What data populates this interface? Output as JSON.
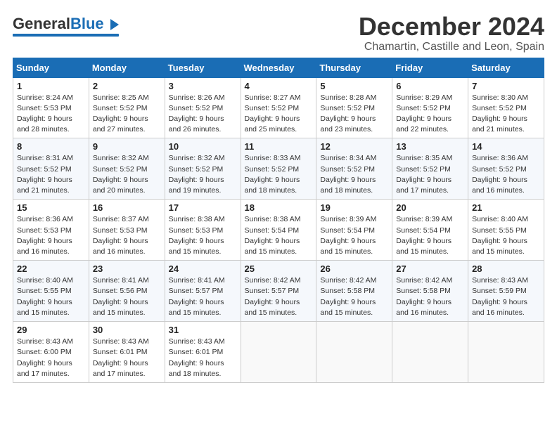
{
  "header": {
    "logo_general": "General",
    "logo_blue": "Blue",
    "main_title": "December 2024",
    "subtitle": "Chamartin, Castille and Leon, Spain"
  },
  "days_of_week": [
    "Sunday",
    "Monday",
    "Tuesday",
    "Wednesday",
    "Thursday",
    "Friday",
    "Saturday"
  ],
  "weeks": [
    [
      {
        "day": 1,
        "sunrise": "8:24 AM",
        "sunset": "5:53 PM",
        "daylight_hours": 9,
        "daylight_minutes": 28
      },
      {
        "day": 2,
        "sunrise": "8:25 AM",
        "sunset": "5:52 PM",
        "daylight_hours": 9,
        "daylight_minutes": 27
      },
      {
        "day": 3,
        "sunrise": "8:26 AM",
        "sunset": "5:52 PM",
        "daylight_hours": 9,
        "daylight_minutes": 26
      },
      {
        "day": 4,
        "sunrise": "8:27 AM",
        "sunset": "5:52 PM",
        "daylight_hours": 9,
        "daylight_minutes": 25
      },
      {
        "day": 5,
        "sunrise": "8:28 AM",
        "sunset": "5:52 PM",
        "daylight_hours": 9,
        "daylight_minutes": 23
      },
      {
        "day": 6,
        "sunrise": "8:29 AM",
        "sunset": "5:52 PM",
        "daylight_hours": 9,
        "daylight_minutes": 22
      },
      {
        "day": 7,
        "sunrise": "8:30 AM",
        "sunset": "5:52 PM",
        "daylight_hours": 9,
        "daylight_minutes": 21
      }
    ],
    [
      {
        "day": 8,
        "sunrise": "8:31 AM",
        "sunset": "5:52 PM",
        "daylight_hours": 9,
        "daylight_minutes": 21
      },
      {
        "day": 9,
        "sunrise": "8:32 AM",
        "sunset": "5:52 PM",
        "daylight_hours": 9,
        "daylight_minutes": 20
      },
      {
        "day": 10,
        "sunrise": "8:32 AM",
        "sunset": "5:52 PM",
        "daylight_hours": 9,
        "daylight_minutes": 19
      },
      {
        "day": 11,
        "sunrise": "8:33 AM",
        "sunset": "5:52 PM",
        "daylight_hours": 9,
        "daylight_minutes": 18
      },
      {
        "day": 12,
        "sunrise": "8:34 AM",
        "sunset": "5:52 PM",
        "daylight_hours": 9,
        "daylight_minutes": 18
      },
      {
        "day": 13,
        "sunrise": "8:35 AM",
        "sunset": "5:52 PM",
        "daylight_hours": 9,
        "daylight_minutes": 17
      },
      {
        "day": 14,
        "sunrise": "8:36 AM",
        "sunset": "5:52 PM",
        "daylight_hours": 9,
        "daylight_minutes": 16
      }
    ],
    [
      {
        "day": 15,
        "sunrise": "8:36 AM",
        "sunset": "5:53 PM",
        "daylight_hours": 9,
        "daylight_minutes": 16
      },
      {
        "day": 16,
        "sunrise": "8:37 AM",
        "sunset": "5:53 PM",
        "daylight_hours": 9,
        "daylight_minutes": 16
      },
      {
        "day": 17,
        "sunrise": "8:38 AM",
        "sunset": "5:53 PM",
        "daylight_hours": 9,
        "daylight_minutes": 15
      },
      {
        "day": 18,
        "sunrise": "8:38 AM",
        "sunset": "5:54 PM",
        "daylight_hours": 9,
        "daylight_minutes": 15
      },
      {
        "day": 19,
        "sunrise": "8:39 AM",
        "sunset": "5:54 PM",
        "daylight_hours": 9,
        "daylight_minutes": 15
      },
      {
        "day": 20,
        "sunrise": "8:39 AM",
        "sunset": "5:54 PM",
        "daylight_hours": 9,
        "daylight_minutes": 15
      },
      {
        "day": 21,
        "sunrise": "8:40 AM",
        "sunset": "5:55 PM",
        "daylight_hours": 9,
        "daylight_minutes": 15
      }
    ],
    [
      {
        "day": 22,
        "sunrise": "8:40 AM",
        "sunset": "5:55 PM",
        "daylight_hours": 9,
        "daylight_minutes": 15
      },
      {
        "day": 23,
        "sunrise": "8:41 AM",
        "sunset": "5:56 PM",
        "daylight_hours": 9,
        "daylight_minutes": 15
      },
      {
        "day": 24,
        "sunrise": "8:41 AM",
        "sunset": "5:57 PM",
        "daylight_hours": 9,
        "daylight_minutes": 15
      },
      {
        "day": 25,
        "sunrise": "8:42 AM",
        "sunset": "5:57 PM",
        "daylight_hours": 9,
        "daylight_minutes": 15
      },
      {
        "day": 26,
        "sunrise": "8:42 AM",
        "sunset": "5:58 PM",
        "daylight_hours": 9,
        "daylight_minutes": 15
      },
      {
        "day": 27,
        "sunrise": "8:42 AM",
        "sunset": "5:58 PM",
        "daylight_hours": 9,
        "daylight_minutes": 16
      },
      {
        "day": 28,
        "sunrise": "8:43 AM",
        "sunset": "5:59 PM",
        "daylight_hours": 9,
        "daylight_minutes": 16
      }
    ],
    [
      {
        "day": 29,
        "sunrise": "8:43 AM",
        "sunset": "6:00 PM",
        "daylight_hours": 9,
        "daylight_minutes": 17
      },
      {
        "day": 30,
        "sunrise": "8:43 AM",
        "sunset": "6:01 PM",
        "daylight_hours": 9,
        "daylight_minutes": 17
      },
      {
        "day": 31,
        "sunrise": "8:43 AM",
        "sunset": "6:01 PM",
        "daylight_hours": 9,
        "daylight_minutes": 18
      },
      null,
      null,
      null,
      null
    ]
  ]
}
